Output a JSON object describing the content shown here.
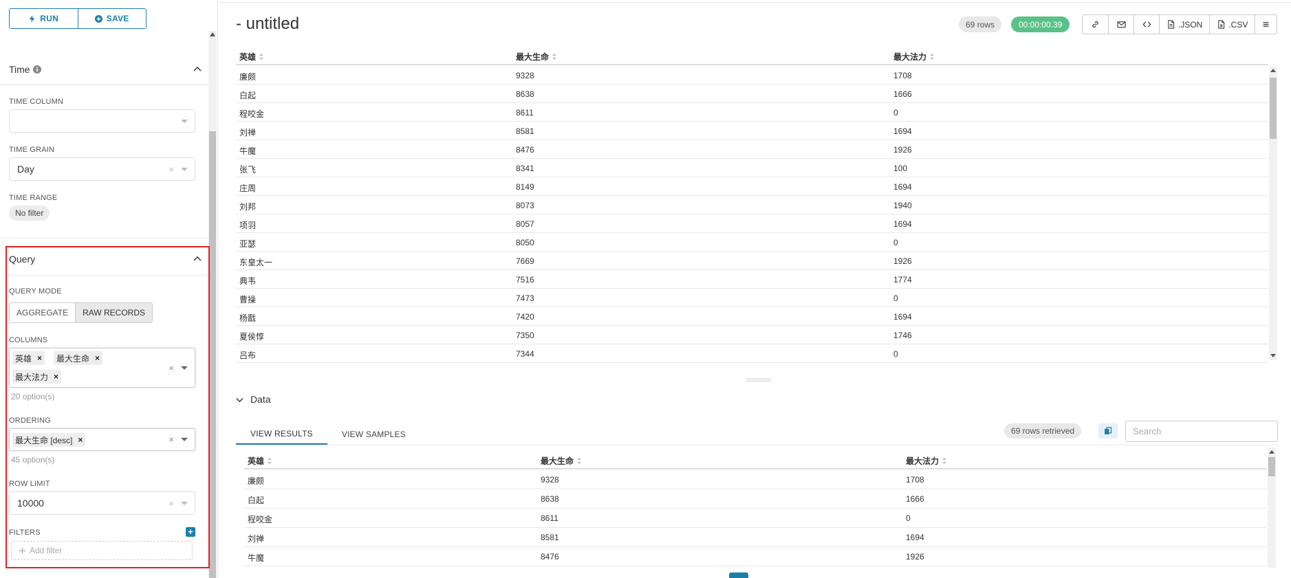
{
  "toolbar_left": {
    "run_label": "RUN",
    "save_label": "SAVE"
  },
  "time_section": {
    "title": "Time",
    "time_column_label": "TIME COLUMN",
    "time_column_value": "",
    "time_grain_label": "TIME GRAIN",
    "time_grain_value": "Day",
    "time_range_label": "TIME RANGE",
    "time_range_value": "No filter"
  },
  "query_section": {
    "title": "Query",
    "query_mode_label": "QUERY MODE",
    "modes": [
      "AGGREGATE",
      "RAW RECORDS"
    ],
    "active_mode": "RAW RECORDS",
    "columns_label": "COLUMNS",
    "columns_tags": [
      "英雄",
      "最大生命",
      "最大法力"
    ],
    "columns_hint": "20 option(s)",
    "ordering_label": "ORDERING",
    "ordering_tags": [
      "最大生命 [desc]"
    ],
    "ordering_hint": "45 option(s)",
    "row_limit_label": "ROW LIMIT",
    "row_limit_value": "10000",
    "filters_label": "FILTERS",
    "add_filter_label": "Add filter",
    "clear_symbol": "×"
  },
  "header": {
    "title": "- untitled",
    "rows_badge": "69 rows",
    "time_badge": "00:00:00.39",
    "json_label": ".JSON",
    "csv_label": ".CSV",
    "accent_color": "#1b7fa7",
    "success_color": "#5ac189"
  },
  "result_table": {
    "columns": [
      "英雄",
      "最大生命",
      "最大法力"
    ],
    "rows": [
      [
        "廉颇",
        "9328",
        "1708"
      ],
      [
        "白起",
        "8638",
        "1666"
      ],
      [
        "程咬金",
        "8611",
        "0"
      ],
      [
        "刘禅",
        "8581",
        "1694"
      ],
      [
        "牛魔",
        "8476",
        "1926"
      ],
      [
        "张飞",
        "8341",
        "100"
      ],
      [
        "庄周",
        "8149",
        "1694"
      ],
      [
        "刘邦",
        "8073",
        "1940"
      ],
      [
        "项羽",
        "8057",
        "1694"
      ],
      [
        "亚瑟",
        "8050",
        "0"
      ],
      [
        "东皇太一",
        "7669",
        "1926"
      ],
      [
        "典韦",
        "7516",
        "1774"
      ],
      [
        "曹操",
        "7473",
        "0"
      ],
      [
        "杨戬",
        "7420",
        "1694"
      ],
      [
        "夏侯惇",
        "7350",
        "1746"
      ],
      [
        "吕布",
        "7344",
        "0"
      ]
    ]
  },
  "data_panel": {
    "title": "Data",
    "tabs": [
      "VIEW RESULTS",
      "VIEW SAMPLES"
    ],
    "active_tab": "VIEW RESULTS",
    "retrieved_badge": "69 rows retrieved",
    "search_placeholder": "Search",
    "columns": [
      "英雄",
      "最大生命",
      "最大法力"
    ],
    "rows": [
      [
        "廉颇",
        "9328",
        "1708"
      ],
      [
        "白起",
        "8638",
        "1666"
      ],
      [
        "程咬金",
        "8611",
        "0"
      ],
      [
        "刘禅",
        "8581",
        "1694"
      ],
      [
        "牛魔",
        "8476",
        "1926"
      ]
    ]
  }
}
